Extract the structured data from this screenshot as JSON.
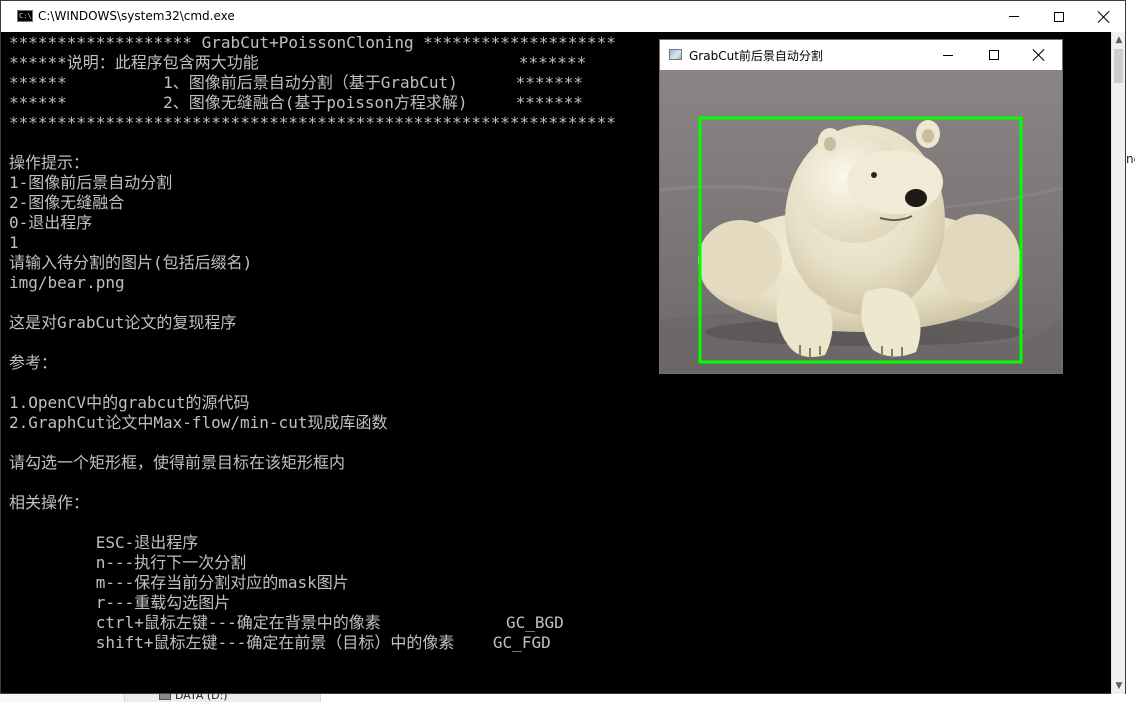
{
  "console_window": {
    "title": "C:\\WINDOWS\\system32\\cmd.exe",
    "icon": "cmd-icon",
    "controls": {
      "minimize": "minimize-icon",
      "maximize": "maximize-icon",
      "close": "close-icon"
    },
    "lines": [
      "******************* GrabCut+PoissonCloning ********************",
      "******说明：此程序包含两大功能                           *******",
      "******          1、图像前后景自动分割（基于GrabCut)      *******",
      "******          2、图像无缝融合(基于poisson方程求解)     *******",
      "***************************************************************",
      "",
      "操作提示：",
      "1-图像前后景自动分割",
      "2-图像无缝融合",
      "0-退出程序",
      "1",
      "请输入待分割的图片(包括后缀名)",
      "img/bear.png",
      "",
      "这是对GrabCut论文的复现程序",
      "",
      "参考：",
      "",
      "1.OpenCV中的grabcut的源代码",
      "2.GraphCut论文中Max-flow/min-cut现成库函数",
      "",
      "请勾选一个矩形框，使得前景目标在该矩形框内",
      "",
      "相关操作：",
      "",
      "         ESC-退出程序",
      "         n---执行下一次分割",
      "         m---保存当前分割对应的mask图片",
      "         r---重载勾选图片",
      "         ctrl+鼠标左键---确定在背景中的像素             GC_BGD",
      "         shift+鼠标左键---确定在前景（目标）中的像素    GC_FGD"
    ]
  },
  "image_window": {
    "title": "GrabCut前后景自动分割",
    "icon": "image-window-icon",
    "image": "polar-bear-photo",
    "selection_rect_color": "#00ff00"
  },
  "background": {
    "drive_label": "DATA (D:)",
    "right_fragment": "ng"
  },
  "colors": {
    "console_bg": "#000000",
    "console_text": "#c0c0c0",
    "titlebar_bg": "#ffffff",
    "accent": "#0078d7"
  }
}
